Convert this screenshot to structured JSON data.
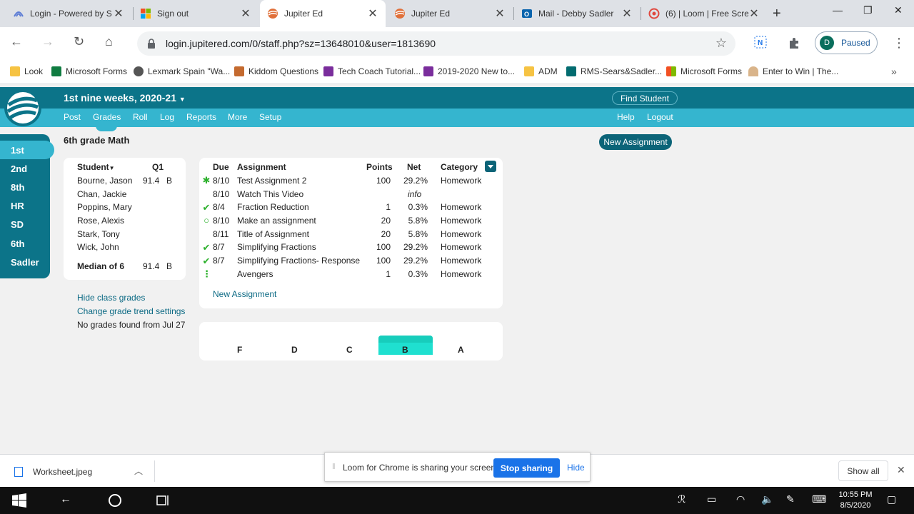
{
  "browser": {
    "tabs": [
      {
        "title": "Login - Powered by S",
        "active": false
      },
      {
        "title": "Sign out",
        "active": false
      },
      {
        "title": "Jupiter Ed",
        "active": true
      },
      {
        "title": "Jupiter Ed",
        "active": false
      },
      {
        "title": "Mail - Debby Sadler",
        "active": false
      },
      {
        "title": "(6) | Loom | Free Scre",
        "active": false
      }
    ],
    "new_tab": "+",
    "url": "login.jupitered.com/0/staff.php?sz=13648010&user=1813690",
    "profile_initial": "D",
    "profile_status": "Paused",
    "bookmarks": [
      "Look",
      "Microsoft Forms",
      "Lexmark Spain \"Wa...",
      "Kiddom Questions",
      "Tech Coach Tutorial...",
      "2019-2020 New to...",
      "ADM",
      "RMS-Sears&Sadler...",
      "Microsoft Forms",
      "Enter to Win | The..."
    ],
    "bookmarks_more": "»"
  },
  "app": {
    "term": "1st nine weeks, 2020-21",
    "find_student": "Find Student",
    "menu": [
      "Post",
      "Grades",
      "Roll",
      "Log",
      "Reports",
      "More",
      "Setup"
    ],
    "help": "Help",
    "logout": "Logout",
    "class_tabs": [
      "1st",
      "2nd",
      "8th",
      "HR",
      "SD",
      "6th",
      "Sadler"
    ],
    "class_title": "6th grade Math",
    "new_assignment_button": "New Assignment"
  },
  "students": {
    "header_student": "Student",
    "header_q1": "Q1",
    "rows": [
      {
        "name": "Bourne, Jason",
        "score": "91.4",
        "grade": "B"
      },
      {
        "name": "Chan, Jackie",
        "score": "",
        "grade": ""
      },
      {
        "name": "Poppins, Mary",
        "score": "",
        "grade": ""
      },
      {
        "name": "Rose, Alexis",
        "score": "",
        "grade": ""
      },
      {
        "name": "Stark, Tony",
        "score": "",
        "grade": ""
      },
      {
        "name": "Wick, John",
        "score": "",
        "grade": ""
      }
    ],
    "median_label": "Median of 6",
    "median_score": "91.4",
    "median_grade": "B",
    "links": {
      "hide_grades": "Hide class grades",
      "trend_settings": "Change grade trend settings",
      "no_grades": "No grades found from Jul 27"
    }
  },
  "assignments": {
    "headers": {
      "due": "Due",
      "assignment": "Assignment",
      "points": "Points",
      "net": "Net",
      "category": "Category"
    },
    "rows": [
      {
        "mark": "✱",
        "due": "8/10",
        "name": "Test Assignment 2",
        "points": "100",
        "net": "29.2%",
        "category": "Homework"
      },
      {
        "mark": "",
        "due": "8/10",
        "name": "Watch This Video",
        "points": "",
        "net": "info",
        "category": ""
      },
      {
        "mark": "✔",
        "due": "8/4",
        "name": "Fraction Reduction",
        "points": "1",
        "net": "0.3%",
        "category": "Homework"
      },
      {
        "mark": "○",
        "due": "8/10",
        "name": "Make an assignment",
        "points": "20",
        "net": "5.8%",
        "category": "Homework"
      },
      {
        "mark": "",
        "due": "8/11",
        "name": "Title of Assignment",
        "points": "20",
        "net": "5.8%",
        "category": "Homework"
      },
      {
        "mark": "✔",
        "due": "8/7",
        "name": "Simplifying Fractions",
        "points": "100",
        "net": "29.2%",
        "category": "Homework"
      },
      {
        "mark": "✔",
        "due": "8/7",
        "name": "Simplifying Fractions- Response",
        "points": "100",
        "net": "29.2%",
        "category": "Homework"
      },
      {
        "mark": "⋮",
        "due": "",
        "name": "Avengers",
        "points": "1",
        "net": "0.3%",
        "category": "Homework"
      }
    ],
    "new_assignment_link": "New Assignment"
  },
  "distribution": {
    "labels": [
      "F",
      "D",
      "C",
      "B",
      "A"
    ],
    "highlight": "B"
  },
  "downloads": {
    "file": "Worksheet.jpeg",
    "show_all": "Show all"
  },
  "loom": {
    "message": "Loom for Chrome is sharing your screen.",
    "stop": "Stop sharing",
    "hide": "Hide"
  },
  "taskbar": {
    "time": "10:55 PM",
    "date": "8/5/2020"
  },
  "colors": {
    "header_dark": "#0c7489",
    "header_light": "#35b5cf",
    "check_green": "#2bb02b",
    "bar_cyan": "#1fe0d0"
  }
}
